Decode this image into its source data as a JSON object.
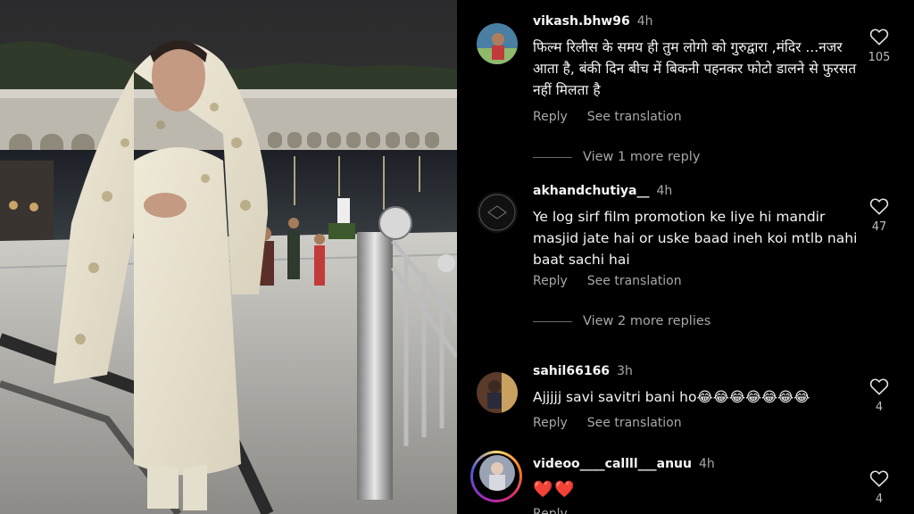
{
  "photo": {
    "alt_icon": "photo-woman-in-white-dupatta-at-gurudwara-sarovar"
  },
  "comments": [
    {
      "username": "vikash.bhw96",
      "time": "4h",
      "text": "फिल्म रिलीस के समय ही तुम लोगो को गुरुद्वारा ,मंदिर ...नजर आता है, बंकी दिन बीच में बिकनी पहनकर फोटो डालने से फुरसत नहीं मिलता है",
      "reply_label": "Reply",
      "translate_label": "See translation",
      "likes": "105",
      "view_more": "View 1 more reply"
    },
    {
      "username": "akhandchutiya__",
      "time": "4h",
      "text": "Ye log sirf film promotion ke liye hi mandir masjid jate hai or uske baad ineh koi mtlb nahi baat sachi hai",
      "reply_label": "Reply",
      "translate_label": "See translation",
      "likes": "47",
      "view_more": "View 2 more replies"
    },
    {
      "username": "sahil66166",
      "time": "3h",
      "text": "Ajjjjj savi savitri bani ho😂😂😂😂😂😂😂",
      "reply_label": "Reply",
      "translate_label": "See translation",
      "likes": "4"
    },
    {
      "username": "videoo____callll___anuu",
      "time": "4h",
      "text": "❤️❤️",
      "likes": "4",
      "reply_label": "Reply"
    }
  ],
  "colors": {
    "background": "#000000",
    "primary_text": "#f5f5f5",
    "secondary_text": "#a8a8a8",
    "heart_red": "#ed4956"
  },
  "icons": {
    "like": "heart-outline-icon"
  }
}
